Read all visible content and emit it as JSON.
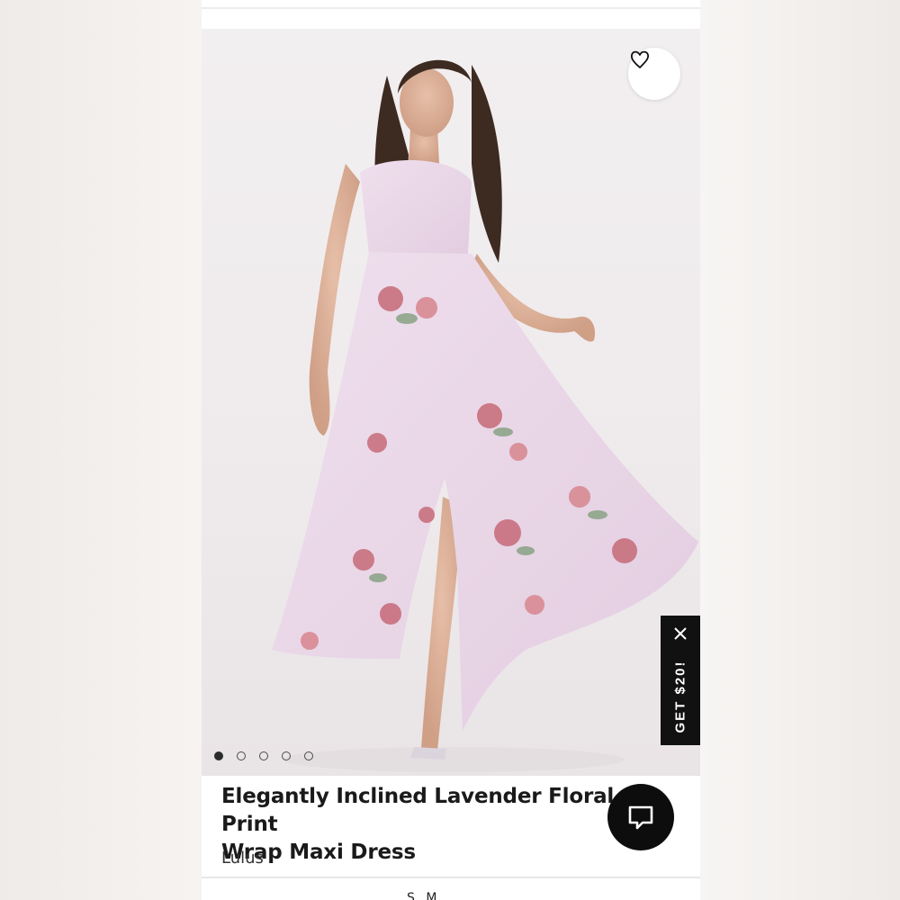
{
  "product": {
    "title": "Elegantly Inclined Lavender Floral Print\nWrap Maxi Dress",
    "brand": "Lulus",
    "image_alt": "Model wearing lavender floral wrap maxi dress",
    "gallery": {
      "total": 5,
      "active_index": 0
    }
  },
  "promo": {
    "label": "GET $20!"
  },
  "colors": {
    "dress": "#e8d6e6",
    "floral_accent": "#c8707e",
    "leaf": "#8ea58a",
    "promo_bg": "#111111",
    "chat_bg": "#0d0d0d"
  },
  "icons": {
    "wishlist": "heart-icon",
    "promo_close": "close-icon",
    "chat": "chat-bubble-icon"
  },
  "size_peek": "S M"
}
